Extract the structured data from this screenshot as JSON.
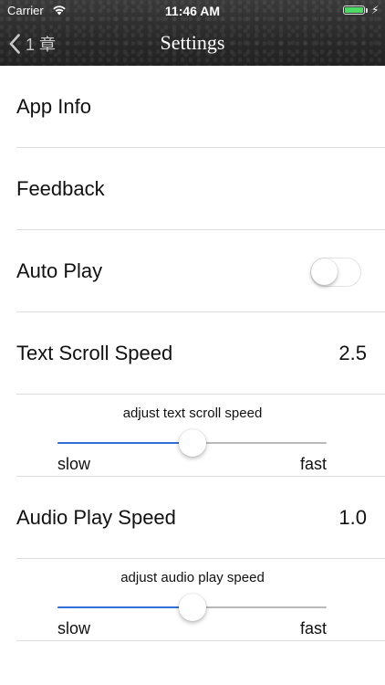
{
  "status_bar": {
    "carrier": "Carrier",
    "time": "11:46 AM",
    "battery_color": "#4cd964"
  },
  "nav": {
    "back_label": "1 章",
    "title": "Settings"
  },
  "rows": {
    "app_info": "App Info",
    "feedback": "Feedback",
    "auto_play": {
      "label": "Auto Play",
      "on": false
    },
    "text_scroll_speed": {
      "label": "Text Scroll Speed",
      "value": "2.5"
    },
    "audio_play_speed": {
      "label": "Audio Play Speed",
      "value": "1.0"
    }
  },
  "sliders": {
    "text_scroll": {
      "caption": "adjust text scroll speed",
      "min_label": "slow",
      "max_label": "fast",
      "level": 0.5
    },
    "audio_play": {
      "caption": "adjust audio play speed",
      "min_label": "slow",
      "max_label": "fast",
      "level": 0.5
    }
  },
  "colors": {
    "accent": "#2f6fd9",
    "track": "#b9b9b9",
    "separator": "#dcdcdc"
  },
  "icons": [
    "wifi-icon",
    "battery-icon",
    "charging-bolt-icon",
    "chevron-left-icon"
  ]
}
